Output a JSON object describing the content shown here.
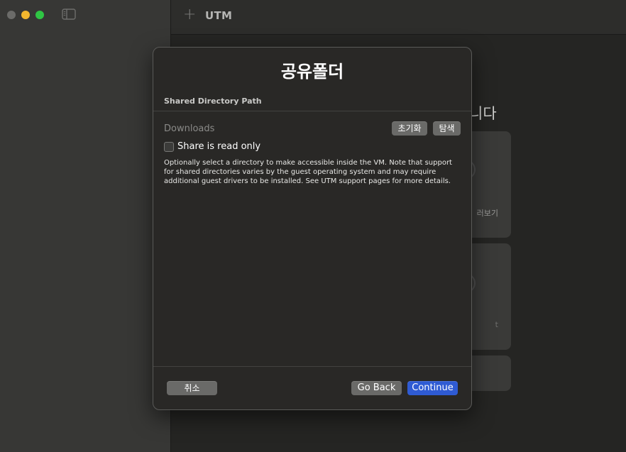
{
  "window": {
    "app_title": "UTM",
    "add_icon": "plus-icon",
    "sidebar_toggle_icon": "sidebar-toggle-icon"
  },
  "background": {
    "heading_fragment": "니다",
    "card1_label": "러보기",
    "card2_label": "t"
  },
  "dialog": {
    "title": "공유폴더",
    "section_header": "Shared Directory Path",
    "path_value": "Downloads",
    "reset_label": "초기화",
    "browse_label": "탐색",
    "read_only_label": "Share is read only",
    "read_only_checked": false,
    "help_text": "Optionally select a directory to make accessible inside the VM. Note that support for shared directories varies by the guest operating system and may require additional guest drivers to be installed. See UTM support pages for more details.",
    "cancel_label": "취소",
    "go_back_label": "Go Back",
    "continue_label": "Continue"
  },
  "colors": {
    "accent": "#2f5bd3",
    "traffic_minimize": "#f3b72e",
    "traffic_zoom": "#2fc544",
    "traffic_close_inactive": "#6b6b69"
  }
}
